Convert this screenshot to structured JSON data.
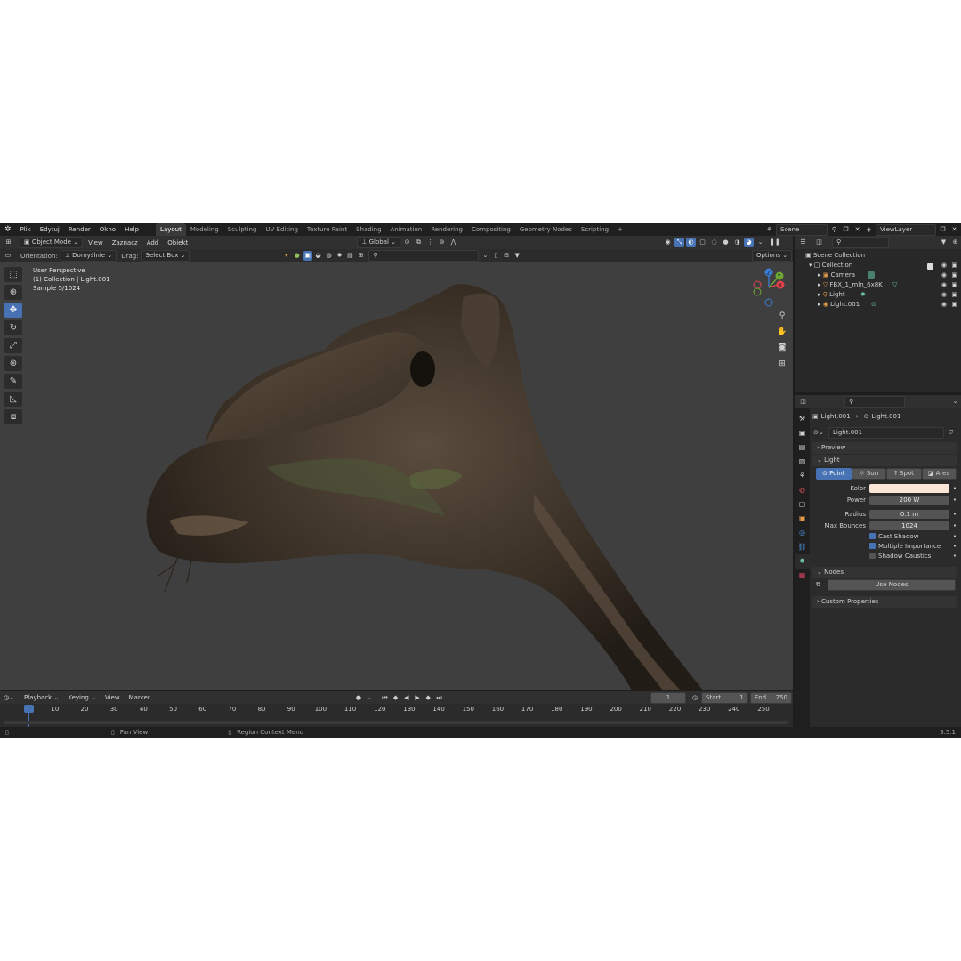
{
  "topbar": {
    "menus": [
      "Plik",
      "Edytuj",
      "Render",
      "Okno",
      "Help"
    ],
    "workspaces": [
      "Layout",
      "Modeling",
      "Sculpting",
      "UV Editing",
      "Texture Paint",
      "Shading",
      "Animation",
      "Rendering",
      "Compositing",
      "Geometry Nodes",
      "Scripting"
    ],
    "active_workspace": "Layout",
    "add_tab": "+",
    "scene": "Scene",
    "view_layer": "ViewLayer"
  },
  "viewport_header": {
    "mode": "Object Mode",
    "menus": [
      "View",
      "Zaznacz",
      "Add",
      "Obiekt"
    ],
    "transform": "Global",
    "options": "Options"
  },
  "tool_settings": {
    "orientation_label": "Orientation:",
    "orientation_value": "Domyślnie",
    "drag_label": "Drag:",
    "drag_value": "Select Box"
  },
  "viewport": {
    "overlay_line1": "User Perspective",
    "overlay_line2": "(1) Collection | Light.001",
    "overlay_line3": "Sample 5/1024",
    "gizmo": {
      "x": "X",
      "y": "Y",
      "z": "Z"
    },
    "colors": {
      "bg": "#3f3f3f",
      "x_axis": "#e0424b",
      "y_axis": "#6ea834",
      "z_axis": "#3b7dd8"
    }
  },
  "outliner": {
    "root": "Scene Collection",
    "collection": "Collection",
    "items": [
      {
        "name": "Camera",
        "icon": "camera-icon"
      },
      {
        "name": "FBX_1_mln_6x8K",
        "icon": "mesh-icon"
      },
      {
        "name": "Light",
        "icon": "light-icon"
      },
      {
        "name": "Light.001",
        "icon": "light-icon"
      }
    ]
  },
  "properties": {
    "breadcrumb_object": "Light.001",
    "breadcrumb_data": "Light.001",
    "datablock_name": "Light.001",
    "panel_preview": "Preview",
    "panel_light": "Light",
    "light_types": [
      "Point",
      "Sun",
      "Spot",
      "Area"
    ],
    "active_light_type": "Point",
    "color_label": "Kolor",
    "color_value": "#fbe5d6",
    "power_label": "Power",
    "power_value": "200 W",
    "radius_label": "Radius",
    "radius_value": "0.1 m",
    "bounces_label": "Max Bounces",
    "bounces_value": "1024",
    "cast_shadow": "Cast Shadow",
    "multiple_importance": "Multiple Importance",
    "shadow_caustics": "Shadow Caustics",
    "panel_nodes": "Nodes",
    "use_nodes": "Use Nodes",
    "panel_custom": "Custom Properties"
  },
  "timeline": {
    "menus": [
      "Playback",
      "Keying",
      "View",
      "Marker"
    ],
    "current_frame": "1",
    "start_label": "Start",
    "start_value": "1",
    "end_label": "End",
    "end_value": "250",
    "ruler": [
      "1",
      "10",
      "20",
      "30",
      "40",
      "50",
      "60",
      "70",
      "80",
      "90",
      "100",
      "110",
      "120",
      "130",
      "140",
      "150",
      "160",
      "170",
      "180",
      "190",
      "200",
      "210",
      "220",
      "230",
      "240",
      "250"
    ]
  },
  "statusbar": {
    "hint1": "Pan View",
    "hint2": "Region Context Menu",
    "version": "3.5.1"
  }
}
